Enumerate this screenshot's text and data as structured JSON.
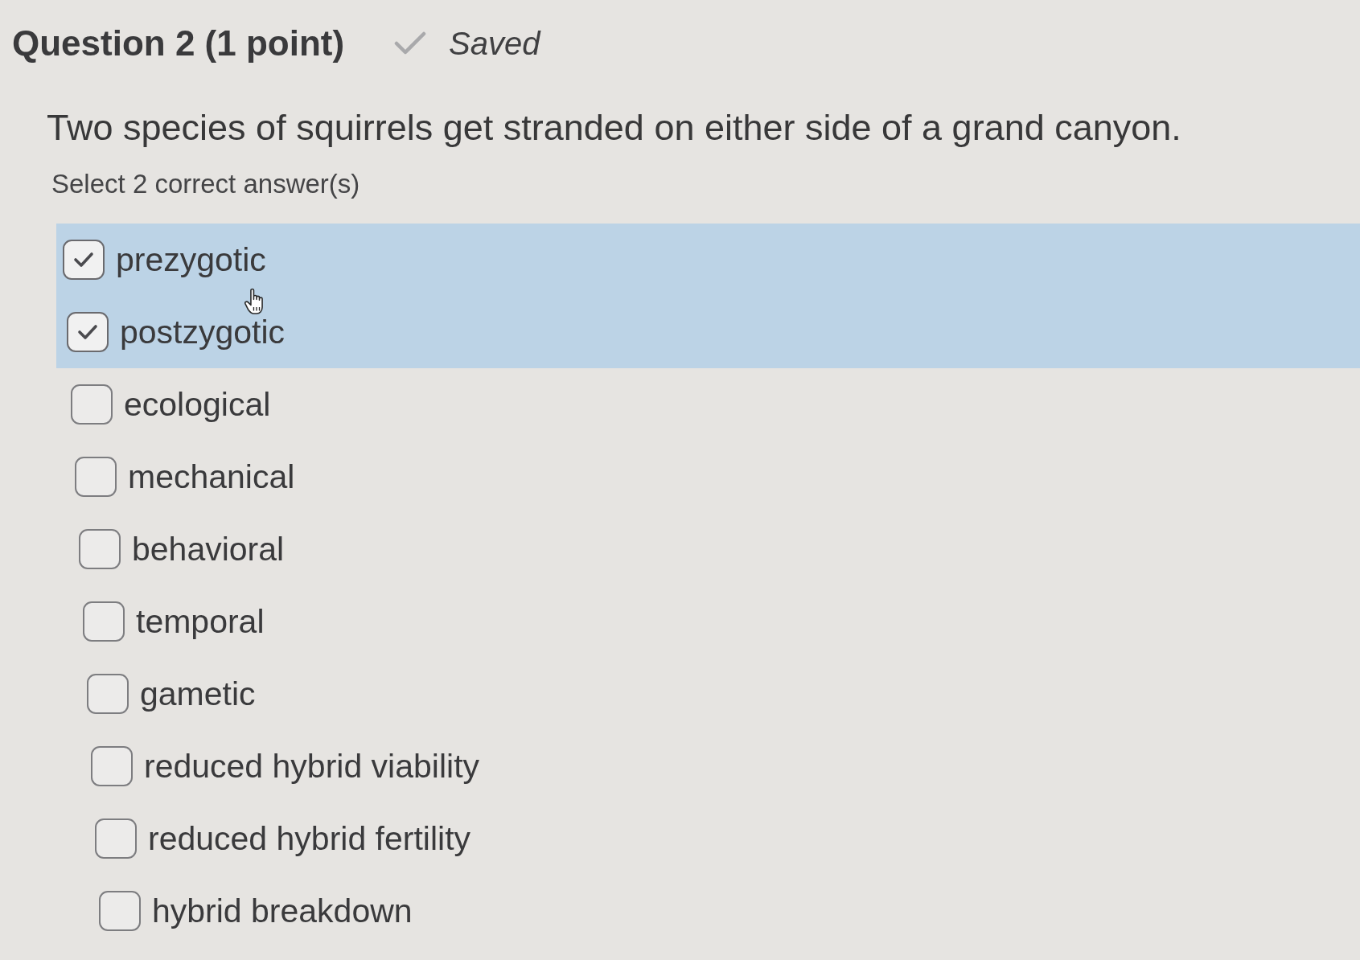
{
  "question": {
    "title": "Question 2 (1 point)",
    "status": "Saved",
    "text": "Two species of squirrels get stranded on either side of a grand canyon.",
    "instruction": "Select 2 correct answer(s)"
  },
  "options": [
    {
      "label": "prezygotic",
      "checked": true
    },
    {
      "label": "postzygotic",
      "checked": true
    },
    {
      "label": "ecological",
      "checked": false
    },
    {
      "label": "mechanical",
      "checked": false
    },
    {
      "label": "behavioral",
      "checked": false
    },
    {
      "label": "temporal",
      "checked": false
    },
    {
      "label": "gametic",
      "checked": false
    },
    {
      "label": "reduced hybrid viability",
      "checked": false
    },
    {
      "label": "reduced hybrid fertility",
      "checked": false
    },
    {
      "label": "hybrid breakdown",
      "checked": false
    }
  ]
}
